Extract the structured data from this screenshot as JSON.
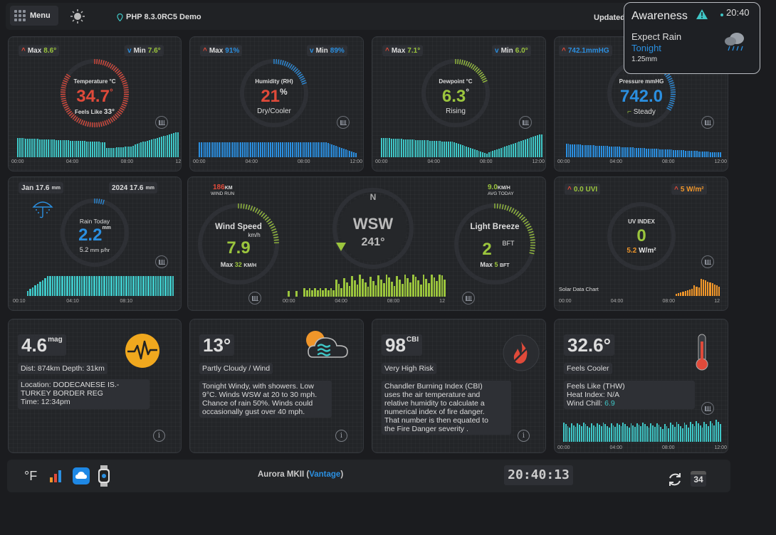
{
  "topbar": {
    "menu_label": "Menu",
    "php_label": "PHP 8.3.0RC5 Demo",
    "updated_label": "Updated"
  },
  "awareness": {
    "title": "Awareness",
    "time": "20:40",
    "forecast": "Expect Rain",
    "when": "Tonight",
    "amount": "1.25mm"
  },
  "axis_default": [
    "00:00",
    "04:00",
    "08:00",
    "12:00"
  ],
  "temperature": {
    "max_label": "Max",
    "max_value": "8.6°",
    "min_label": "Min",
    "min_value": "7.6°",
    "title": "Temperature °C",
    "value": "34.7",
    "unit": "°",
    "feels_prefix": "Feels Like",
    "feels_value": "33°",
    "ring_fraction": 0.85,
    "color": "#e04a3a"
  },
  "humidity": {
    "max_label": "Max",
    "max_value": "91%",
    "min_label": "Min",
    "min_value": "89%",
    "title": "Humidity (RH)",
    "value": "21",
    "unit": "%",
    "sub": "Dry/Cooler",
    "ring_fraction": 0.21,
    "color": "#2b8fe0"
  },
  "dewpoint": {
    "max_label": "Max",
    "max_value": "7.1°",
    "min_label": "Min",
    "min_value": "6.0°",
    "title": "Dewpoint °C",
    "value": "6.3",
    "unit": "°",
    "sub": "Rising",
    "ring_fraction": 0.2,
    "color": "#9bc53d"
  },
  "pressure": {
    "max_value": "742.1mmHG",
    "title": "Pressure mmHG",
    "value": "742.0",
    "sub": "Steady",
    "ring_fraction": 0.35,
    "color": "#2b8fe0"
  },
  "rain": {
    "month": "Jan 17.6",
    "month_unit": "mm",
    "year": "2024 17.6",
    "year_unit": "mm",
    "title": "Rain Today",
    "value": "2.2",
    "unit": "mm",
    "rate_value": "5.2",
    "rate_unit": "mm p/hr",
    "ring_fraction": 0.05,
    "axis": [
      "00:10",
      "04:10",
      "08:10"
    ],
    "color": "#2b8fe0"
  },
  "wind": {
    "run_value": "186",
    "run_unit": "KM",
    "run_label": "WIND RUN",
    "speed_title": "Wind Speed",
    "speed_unit": "km/h",
    "speed_value": "7.9",
    "speed_max_label": "Max",
    "speed_max_value": "32",
    "speed_max_unit": "KM/H",
    "compass_n": "N",
    "direction": "WSW",
    "degrees": "241°",
    "avg_value": "9.0",
    "avg_unit": "KM/H",
    "avg_label": "AVG TODAY",
    "bft_title": "Light Breeze",
    "bft_value": "2",
    "bft_unit": "BFT",
    "bft_max_label": "Max",
    "bft_max_value": "5",
    "bft_max_unit": "BFT",
    "axis": [
      "00:00",
      "04:00",
      "08:00",
      "12"
    ],
    "speed_fraction": 0.25,
    "bft_fraction": 0.3
  },
  "uv": {
    "uv_max": "0.0 UVI",
    "solar_max": "5 W/m²",
    "title": "UV INDEX",
    "value": "0",
    "solar_value": "5.2",
    "solar_unit": "W/m²",
    "chart_label": "Solar Data Chart",
    "axis": [
      "00:00",
      "04:00",
      "08:00",
      "12"
    ]
  },
  "earthquake": {
    "mag_value": "4.6",
    "mag_unit": "mag",
    "dist": "Dist: 874km Depth: 31km",
    "location_lines": [
      "Location: DODECANESE IS.-",
      "TURKEY BORDER REG",
      "Time: 12:34pm"
    ]
  },
  "forecast": {
    "temp": "13°",
    "summary": "Partly Cloudy / Wind",
    "text_lines": [
      "Tonight Windy, with showers. Low",
      "9°C. Winds WSW at 20 to 30 mph.",
      "Chance of rain 50%. Winds could",
      "occasionally gust over 40 mph."
    ]
  },
  "fire": {
    "value": "98",
    "unit": "CBI",
    "risk": "Very High Risk",
    "text_lines": [
      "Chandler Burning Index (CBI)",
      "uses the air temperature and",
      "relative humidity to calculate a",
      "numerical index of fire danger.",
      "That number is then equated to",
      "the Fire Danger severity ."
    ]
  },
  "feels": {
    "value": "32.6°",
    "label": "Feels Cooler",
    "line1": "Feels Like (THW)",
    "line2": "Heat Index: N/A",
    "line3_prefix": "Wind Chill:",
    "line3_value": "6.9"
  },
  "footer": {
    "unit_toggle": "°F",
    "station_prefix": "Aurora MKII (",
    "station_link": "Vantage",
    "station_suffix": ")",
    "clock": "20:40:13",
    "calendar_day": "34"
  }
}
